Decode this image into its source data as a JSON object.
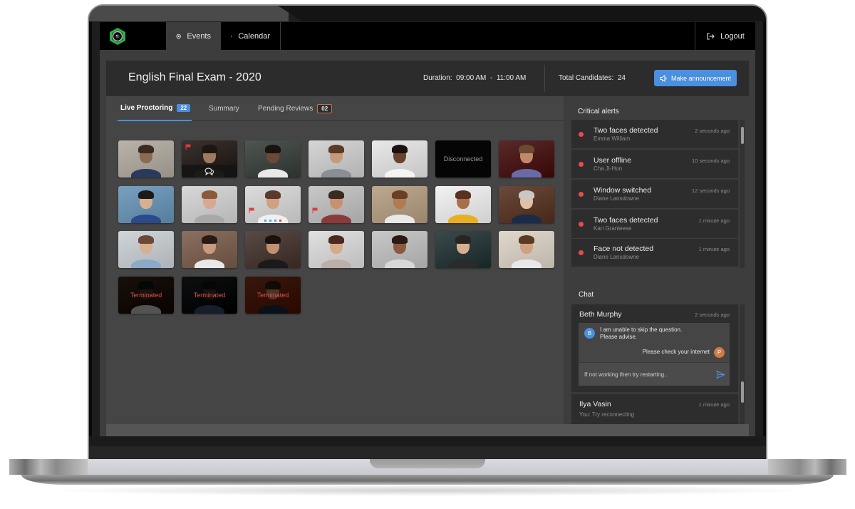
{
  "nav": {
    "tabs": [
      {
        "label": "Events",
        "icon": "target-icon",
        "active": true
      },
      {
        "label": "Calendar",
        "icon": "calendar-icon",
        "active": false
      }
    ],
    "logout_label": "Logout"
  },
  "header": {
    "title": "English Final Exam - 2020",
    "duration_label": "Duration:",
    "duration_value": "09:00 AM  -  11:00 AM",
    "total_label": "Total Candidates:",
    "total_value": "24",
    "announce_label": "Make announcement"
  },
  "tabs": [
    {
      "label": "Live Proctoring",
      "badge": "22",
      "active": true
    },
    {
      "label": "Summary",
      "badge": null,
      "active": false
    },
    {
      "label": "Pending Reviews",
      "badge": "02",
      "active": false
    }
  ],
  "candidates": {
    "disconnected_label": "Disconnected",
    "terminated_label": "Terminated",
    "tiles": [
      {
        "status": "live",
        "flag": false,
        "chat": false
      },
      {
        "status": "live",
        "flag": true,
        "chat": true
      },
      {
        "status": "live",
        "flag": false,
        "chat": false
      },
      {
        "status": "live",
        "flag": false,
        "chat": false
      },
      {
        "status": "live",
        "flag": false,
        "chat": false
      },
      {
        "status": "disconnected",
        "flag": false,
        "chat": false
      },
      {
        "status": "live",
        "flag": false,
        "chat": false
      },
      {
        "status": "live",
        "flag": false,
        "chat": false
      },
      {
        "status": "live",
        "flag": false,
        "chat": false
      },
      {
        "status": "live",
        "flag": true,
        "chat": false,
        "screen_dots": true
      },
      {
        "status": "live",
        "flag": true,
        "chat": false
      },
      {
        "status": "live",
        "flag": false,
        "chat": false
      },
      {
        "status": "live",
        "flag": false,
        "chat": false
      },
      {
        "status": "live",
        "flag": false,
        "chat": false
      },
      {
        "status": "live",
        "flag": false,
        "chat": false
      },
      {
        "status": "live",
        "flag": false,
        "chat": false
      },
      {
        "status": "live",
        "flag": false,
        "chat": false
      },
      {
        "status": "live",
        "flag": false,
        "chat": false
      },
      {
        "status": "live",
        "flag": false,
        "chat": false
      },
      {
        "status": "live",
        "flag": false,
        "chat": false
      },
      {
        "status": "live",
        "flag": false,
        "chat": false
      },
      {
        "status": "terminated",
        "flag": false,
        "chat": false
      },
      {
        "status": "terminated",
        "flag": false,
        "chat": false
      },
      {
        "status": "terminated",
        "flag": false,
        "chat": false
      }
    ]
  },
  "alerts": {
    "title": "Critical alerts",
    "items": [
      {
        "title": "Two faces detected",
        "name": "Emma William",
        "time": "2 seconds ago"
      },
      {
        "title": "User offline",
        "name": "Cha Ji-Hun",
        "time": "10 seconds ago"
      },
      {
        "title": "Window switched",
        "name": "Diane Lansdowne",
        "time": "12 seconds ago"
      },
      {
        "title": "Two faces detected",
        "name": "Kari Granleese",
        "time": "1 minute ago"
      },
      {
        "title": "Face not detected",
        "name": "Diane Lansdowne",
        "time": "1 minute ago"
      }
    ]
  },
  "chat": {
    "title": "Chat",
    "threads": [
      {
        "name": "Beth Murphy",
        "time": "2 seconds ago",
        "incoming": {
          "avatar": "B",
          "text_line1": "I am unable to skip the question.",
          "text_line2": "Please advise."
        },
        "outgoing": {
          "avatar": "P",
          "text": "Please check your internet"
        },
        "input_value": "If not working then try restarting.."
      },
      {
        "name": "Ilya Vasin",
        "time": "1 minute ago",
        "preview": "You: Try reconnecting"
      }
    ]
  },
  "colors": {
    "accent": "#4a8fe0",
    "alert": "#e84b4b",
    "terminated": "#d9534f",
    "pending_badge": "#c8714a"
  }
}
